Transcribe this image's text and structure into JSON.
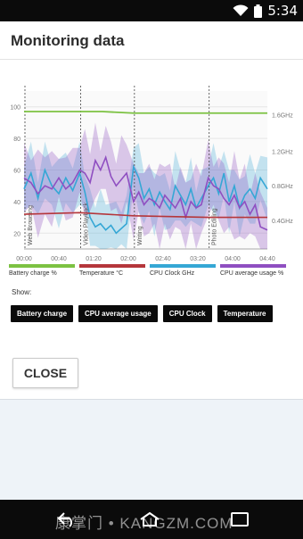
{
  "status_bar": {
    "time": "5:34"
  },
  "dialog": {
    "title": "Monitoring data",
    "show_label": "Show:",
    "close_label": "CLOSE"
  },
  "filters": [
    {
      "label": "Battery charge"
    },
    {
      "label": "CPU average usage"
    },
    {
      "label": "CPU Clock"
    },
    {
      "label": "Temperature"
    }
  ],
  "watermark": "康掌门 • KANGZM.COM",
  "chart_data": {
    "type": "line",
    "y_left_ticks": [
      "20",
      "40",
      "60",
      "80",
      "100"
    ],
    "y_right_ticks": [
      "0.4GHz",
      "0.8GHz",
      "1.2GHz",
      "1.6GHz"
    ],
    "x_ticks": [
      "00:00",
      "00:40",
      "01:20",
      "02:00",
      "02:40",
      "03:20",
      "04:00",
      "04:40"
    ],
    "ylim": [
      10,
      110
    ],
    "xlim": [
      0,
      280
    ],
    "segments": [
      {
        "label": "Web Browsing",
        "x": 0
      },
      {
        "label": "Video Playback",
        "x": 64
      },
      {
        "label": "Writing",
        "x": 126
      },
      {
        "label": "Photo Editing",
        "x": 212
      }
    ],
    "legend": [
      {
        "name": "Battery charge %",
        "color": "#7cc242"
      },
      {
        "name": "Temperature °C",
        "color": "#b5363b"
      },
      {
        "name": "CPU Clock GHz",
        "color": "#35a7d5"
      },
      {
        "name": "CPU average usage %",
        "color": "#8f4fc1"
      }
    ],
    "battery": {
      "x": [
        0,
        64,
        90,
        126,
        160,
        212,
        280
      ],
      "y": [
        97,
        97,
        97,
        96,
        96,
        96,
        96
      ]
    },
    "temperature": {
      "x": [
        0,
        64,
        126,
        212,
        280
      ],
      "y": [
        32,
        33,
        31,
        30,
        30
      ]
    },
    "cpu_clock": {
      "x": [
        0,
        8,
        16,
        24,
        32,
        40,
        48,
        56,
        64,
        70,
        76,
        82,
        88,
        94,
        100,
        106,
        112,
        118,
        126,
        132,
        138,
        144,
        150,
        156,
        162,
        168,
        174,
        180,
        186,
        192,
        198,
        204,
        212,
        218,
        224,
        230,
        236,
        242,
        248,
        254,
        260,
        266,
        272,
        280
      ],
      "y": [
        48,
        58,
        42,
        60,
        50,
        45,
        55,
        47,
        58,
        46,
        30,
        24,
        26,
        22,
        25,
        20,
        23,
        26,
        62,
        55,
        42,
        48,
        38,
        46,
        40,
        35,
        50,
        44,
        38,
        48,
        36,
        42,
        50,
        55,
        45,
        58,
        40,
        50,
        36,
        44,
        48,
        42,
        55,
        48
      ]
    },
    "cpu_usage": {
      "x": [
        0,
        8,
        16,
        24,
        32,
        40,
        48,
        56,
        64,
        70,
        76,
        82,
        88,
        94,
        100,
        106,
        112,
        118,
        126,
        132,
        138,
        144,
        150,
        156,
        162,
        168,
        174,
        180,
        186,
        192,
        198,
        204,
        212,
        218,
        224,
        230,
        236,
        242,
        248,
        254,
        260,
        266,
        272,
        280
      ],
      "y": [
        55,
        52,
        45,
        50,
        48,
        55,
        48,
        52,
        60,
        58,
        52,
        66,
        60,
        68,
        56,
        50,
        54,
        58,
        40,
        46,
        38,
        42,
        40,
        36,
        44,
        40,
        36,
        42,
        30,
        40,
        36,
        38,
        55,
        50,
        48,
        42,
        38,
        44,
        36,
        40,
        32,
        38,
        24,
        22
      ]
    }
  }
}
